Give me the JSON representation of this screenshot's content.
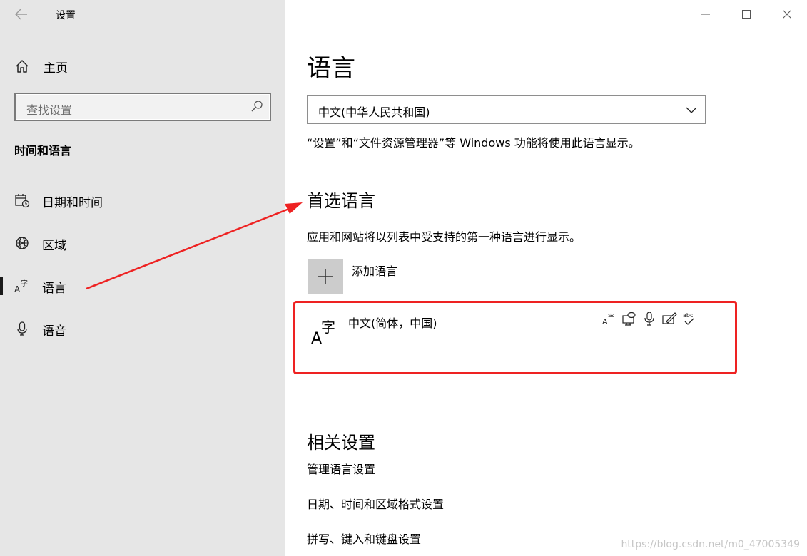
{
  "app": {
    "title": "设置"
  },
  "sidebar": {
    "home_label": "主页",
    "search_placeholder": "查找设置",
    "section_title": "时间和语言",
    "items": [
      {
        "label": "日期和时间",
        "icon": "calendar-clock-icon",
        "selected": false
      },
      {
        "label": "区域",
        "icon": "globe-icon",
        "selected": false
      },
      {
        "label": "语言",
        "icon": "language-icon",
        "selected": true
      },
      {
        "label": "语音",
        "icon": "microphone-icon",
        "selected": false
      }
    ]
  },
  "main": {
    "title": "语言",
    "display_language": {
      "value": "中文(中华人民共和国)",
      "description": "“设置”和“文件资源管理器”等 Windows 功能将使用此语言显示。"
    },
    "preferred": {
      "heading": "首选语言",
      "description": "应用和网站将以列表中受支持的第一种语言进行显示。",
      "add_label": "添加语言",
      "languages": [
        {
          "name": "中文(简体，中国)",
          "features": [
            "display-language-icon",
            "text-to-speech-icon",
            "speech-recognition-icon",
            "handwriting-icon",
            "spell-check-icon"
          ]
        }
      ]
    },
    "related": {
      "heading": "相关设置",
      "links": [
        "管理语言设置",
        "日期、时间和区域格式设置",
        "拼写、键入和键盘设置"
      ]
    }
  },
  "watermark": "https://blog.csdn.net/m0_47005349",
  "colors": {
    "sidebar_bg": "#e6e6e6",
    "annotation_red": "#ee2222",
    "add_button_bg": "#cccccc"
  }
}
